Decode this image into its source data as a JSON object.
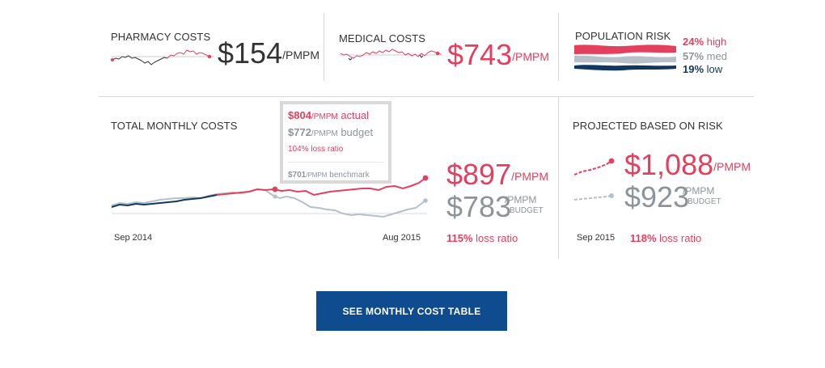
{
  "pharmacy": {
    "label": "PHARMACY COSTS",
    "value": "$154",
    "unit": "/PMPM"
  },
  "medical": {
    "label": "MEDICAL COSTS",
    "value": "$743",
    "unit": "/PMPM"
  },
  "risk": {
    "label": "POPULATION RISK",
    "high_pct": "24%",
    "high_label": "high",
    "med_pct": "57%",
    "med_label": "med",
    "low_pct": "19%",
    "low_label": "low",
    "colors": {
      "high": "#e3405f",
      "med": "#b7c0c8",
      "low": "#12375e"
    }
  },
  "total": {
    "label": "TOTAL MONTHLY COSTS",
    "x_start": "Sep 2014",
    "x_end": "Aug 2015",
    "actual_value": "$897",
    "actual_unit": "/PMPM",
    "budget_value": "$783",
    "budget_unit_top": "/PMPM",
    "budget_unit_bottom": "BUDGET",
    "loss_pct": "115%",
    "loss_label": "loss ratio",
    "tooltip": {
      "actual_value": "$804",
      "actual_unit": "/PMPM",
      "actual_label": "actual",
      "budget_value": "$772",
      "budget_unit": "/PMPM",
      "budget_label": "budget",
      "loss": "104% loss ratio",
      "bench_value": "$701",
      "bench_unit": "/PMPM",
      "bench_label": "benchmark"
    }
  },
  "projected": {
    "label": "PROJECTED BASED ON RISK",
    "actual_value": "$1,088",
    "actual_unit": "/PMPM",
    "budget_value": "$923",
    "budget_unit_top": "/PMPM",
    "budget_unit_bottom": "BUDGET",
    "date": "Sep 2015",
    "loss_pct": "118%",
    "loss_label": "loss ratio"
  },
  "cta": {
    "label": "SEE MONTHLY COST TABLE"
  },
  "colors": {
    "actual": "#e3405f",
    "budget": "#b7c0c8",
    "history": "#12375e",
    "button": "#0f4b8f"
  }
}
